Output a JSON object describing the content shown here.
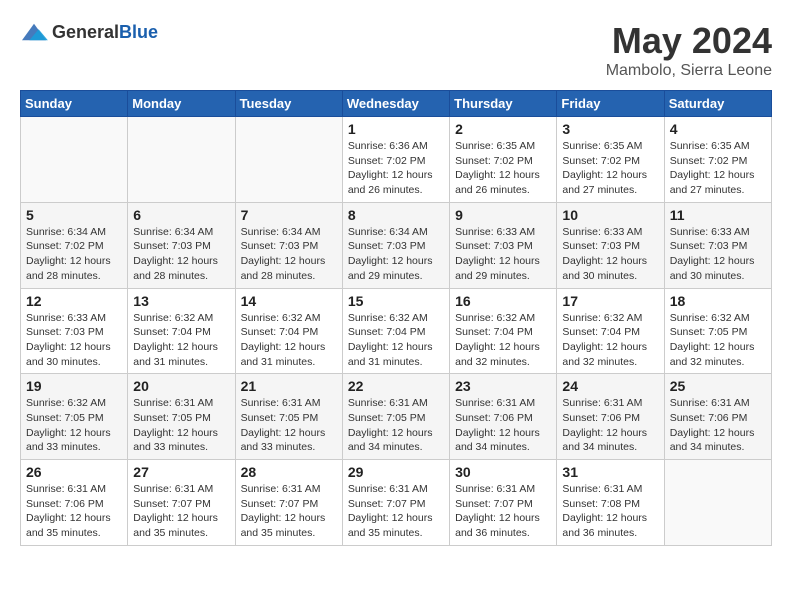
{
  "header": {
    "logo": {
      "general": "General",
      "blue": "Blue"
    },
    "title": "May 2024",
    "location": "Mambolo, Sierra Leone"
  },
  "weekdays": [
    "Sunday",
    "Monday",
    "Tuesday",
    "Wednesday",
    "Thursday",
    "Friday",
    "Saturday"
  ],
  "weeks": [
    [
      {
        "day": "",
        "info": ""
      },
      {
        "day": "",
        "info": ""
      },
      {
        "day": "",
        "info": ""
      },
      {
        "day": "1",
        "info": "Sunrise: 6:36 AM\nSunset: 7:02 PM\nDaylight: 12 hours and 26 minutes."
      },
      {
        "day": "2",
        "info": "Sunrise: 6:35 AM\nSunset: 7:02 PM\nDaylight: 12 hours and 26 minutes."
      },
      {
        "day": "3",
        "info": "Sunrise: 6:35 AM\nSunset: 7:02 PM\nDaylight: 12 hours and 27 minutes."
      },
      {
        "day": "4",
        "info": "Sunrise: 6:35 AM\nSunset: 7:02 PM\nDaylight: 12 hours and 27 minutes."
      }
    ],
    [
      {
        "day": "5",
        "info": "Sunrise: 6:34 AM\nSunset: 7:02 PM\nDaylight: 12 hours and 28 minutes."
      },
      {
        "day": "6",
        "info": "Sunrise: 6:34 AM\nSunset: 7:03 PM\nDaylight: 12 hours and 28 minutes."
      },
      {
        "day": "7",
        "info": "Sunrise: 6:34 AM\nSunset: 7:03 PM\nDaylight: 12 hours and 28 minutes."
      },
      {
        "day": "8",
        "info": "Sunrise: 6:34 AM\nSunset: 7:03 PM\nDaylight: 12 hours and 29 minutes."
      },
      {
        "day": "9",
        "info": "Sunrise: 6:33 AM\nSunset: 7:03 PM\nDaylight: 12 hours and 29 minutes."
      },
      {
        "day": "10",
        "info": "Sunrise: 6:33 AM\nSunset: 7:03 PM\nDaylight: 12 hours and 30 minutes."
      },
      {
        "day": "11",
        "info": "Sunrise: 6:33 AM\nSunset: 7:03 PM\nDaylight: 12 hours and 30 minutes."
      }
    ],
    [
      {
        "day": "12",
        "info": "Sunrise: 6:33 AM\nSunset: 7:03 PM\nDaylight: 12 hours and 30 minutes."
      },
      {
        "day": "13",
        "info": "Sunrise: 6:32 AM\nSunset: 7:04 PM\nDaylight: 12 hours and 31 minutes."
      },
      {
        "day": "14",
        "info": "Sunrise: 6:32 AM\nSunset: 7:04 PM\nDaylight: 12 hours and 31 minutes."
      },
      {
        "day": "15",
        "info": "Sunrise: 6:32 AM\nSunset: 7:04 PM\nDaylight: 12 hours and 31 minutes."
      },
      {
        "day": "16",
        "info": "Sunrise: 6:32 AM\nSunset: 7:04 PM\nDaylight: 12 hours and 32 minutes."
      },
      {
        "day": "17",
        "info": "Sunrise: 6:32 AM\nSunset: 7:04 PM\nDaylight: 12 hours and 32 minutes."
      },
      {
        "day": "18",
        "info": "Sunrise: 6:32 AM\nSunset: 7:05 PM\nDaylight: 12 hours and 32 minutes."
      }
    ],
    [
      {
        "day": "19",
        "info": "Sunrise: 6:32 AM\nSunset: 7:05 PM\nDaylight: 12 hours and 33 minutes."
      },
      {
        "day": "20",
        "info": "Sunrise: 6:31 AM\nSunset: 7:05 PM\nDaylight: 12 hours and 33 minutes."
      },
      {
        "day": "21",
        "info": "Sunrise: 6:31 AM\nSunset: 7:05 PM\nDaylight: 12 hours and 33 minutes."
      },
      {
        "day": "22",
        "info": "Sunrise: 6:31 AM\nSunset: 7:05 PM\nDaylight: 12 hours and 34 minutes."
      },
      {
        "day": "23",
        "info": "Sunrise: 6:31 AM\nSunset: 7:06 PM\nDaylight: 12 hours and 34 minutes."
      },
      {
        "day": "24",
        "info": "Sunrise: 6:31 AM\nSunset: 7:06 PM\nDaylight: 12 hours and 34 minutes."
      },
      {
        "day": "25",
        "info": "Sunrise: 6:31 AM\nSunset: 7:06 PM\nDaylight: 12 hours and 34 minutes."
      }
    ],
    [
      {
        "day": "26",
        "info": "Sunrise: 6:31 AM\nSunset: 7:06 PM\nDaylight: 12 hours and 35 minutes."
      },
      {
        "day": "27",
        "info": "Sunrise: 6:31 AM\nSunset: 7:07 PM\nDaylight: 12 hours and 35 minutes."
      },
      {
        "day": "28",
        "info": "Sunrise: 6:31 AM\nSunset: 7:07 PM\nDaylight: 12 hours and 35 minutes."
      },
      {
        "day": "29",
        "info": "Sunrise: 6:31 AM\nSunset: 7:07 PM\nDaylight: 12 hours and 35 minutes."
      },
      {
        "day": "30",
        "info": "Sunrise: 6:31 AM\nSunset: 7:07 PM\nDaylight: 12 hours and 36 minutes."
      },
      {
        "day": "31",
        "info": "Sunrise: 6:31 AM\nSunset: 7:08 PM\nDaylight: 12 hours and 36 minutes."
      },
      {
        "day": "",
        "info": ""
      }
    ]
  ]
}
